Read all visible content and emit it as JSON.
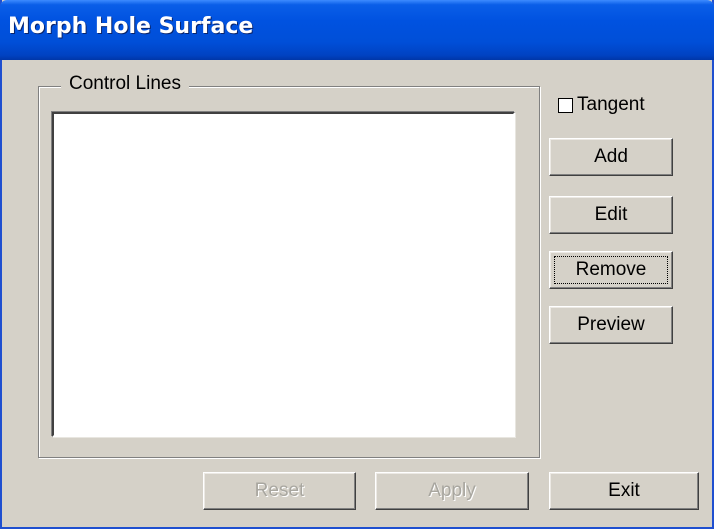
{
  "window": {
    "title": "Morph Hole Surface"
  },
  "group": {
    "legend": "Control Lines"
  },
  "options": {
    "tangent_label": "Tangent",
    "tangent_checked": false
  },
  "side_buttons": {
    "add": "Add",
    "edit": "Edit",
    "remove": "Remove",
    "preview": "Preview"
  },
  "footer": {
    "reset": "Reset",
    "apply": "Apply",
    "exit": "Exit"
  },
  "colors": {
    "titlebar": "#0052e0",
    "face": "#d5d1c8"
  }
}
